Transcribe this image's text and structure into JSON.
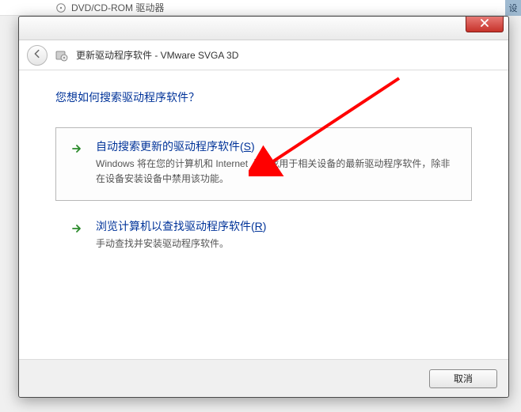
{
  "background": {
    "device_row": "DVD/CD-ROM 驱动器",
    "side_label": "设"
  },
  "dialog": {
    "title": "更新驱动程序软件 - VMware SVGA 3D",
    "heading": "您想如何搜索驱动程序软件？",
    "options": [
      {
        "title_prefix": "自动搜索更新的驱动程序软件(",
        "title_hotkey": "S",
        "title_suffix": ")",
        "desc": "Windows 将在您的计算机和 Internet 上查找用于相关设备的最新驱动程序软件，除非在设备安装设备中禁用该功能。"
      },
      {
        "title_prefix": "浏览计算机以查找驱动程序软件(",
        "title_hotkey": "R",
        "title_suffix": ")",
        "desc": "手动查找并安装驱动程序软件。"
      }
    ],
    "footer": {
      "cancel": "取消"
    }
  }
}
